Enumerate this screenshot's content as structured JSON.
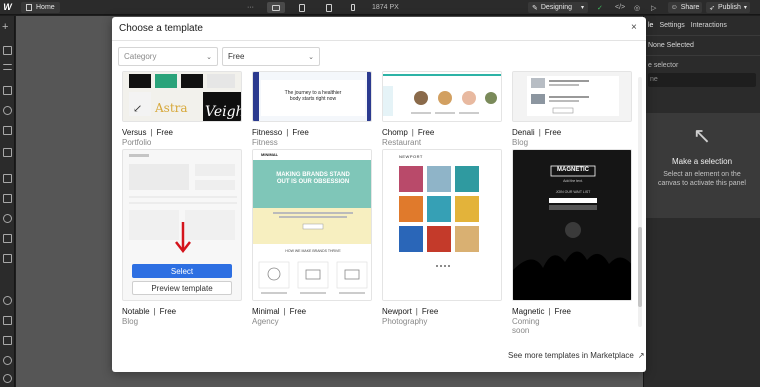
{
  "topbar": {
    "logo": "W",
    "page": "Home",
    "more": "···",
    "breakpoint_width": "1874 PX",
    "mode": "Designing",
    "share": "Share",
    "publish": "Publish"
  },
  "right_panel": {
    "tabs": [
      "le",
      "Settings",
      "Interactions"
    ],
    "none_selected": "None Selected",
    "selector_label": "e selector",
    "selector_placeholder": "ne",
    "empty_title": "Make a selection",
    "empty_desc": "Select an element on the canvas to activate this panel"
  },
  "modal": {
    "title": "Choose a template",
    "close": "×",
    "filters": {
      "category_placeholder": "Category",
      "price_value": "Free"
    },
    "templates_row1": [
      {
        "name": "Versus",
        "price": "Free",
        "category": "Portfolio"
      },
      {
        "name": "Fitnesso",
        "price": "Free",
        "category": "Fitness"
      },
      {
        "name": "Chomp",
        "price": "Free",
        "category": "Restaurant"
      },
      {
        "name": "Denali",
        "price": "Free",
        "category": "Blog"
      }
    ],
    "templates_row2": [
      {
        "name": "Notable",
        "price": "Free",
        "category": "Blog"
      },
      {
        "name": "Minimal",
        "price": "Free",
        "category": "Agency"
      },
      {
        "name": "Newport",
        "price": "Free",
        "category": "Photography"
      },
      {
        "name": "Magnetic",
        "price": "Free",
        "category": "Coming soon"
      }
    ],
    "select_label": "Select",
    "preview_label": "Preview template",
    "marketplace_link": "See more templates in Marketplace",
    "thumb_text": {
      "fitnesso_headline": "The journey to a healthier body starts right now",
      "versus_words": [
        "Astra",
        "Veigh"
      ],
      "minimal_headline": "MAKING BRANDS STAND OUT IS OUR OBSESSION",
      "minimal_sub": "HOW WE MAKE BRANDS THRIVE",
      "minimal_logo": "MINIMAL",
      "newport_logo": "NEWPORT",
      "magnetic_logo": "MAGNETIC",
      "magnetic_sub": "Add the text.",
      "magnetic_cta": "JOIN OUR WAIT LIST"
    }
  }
}
